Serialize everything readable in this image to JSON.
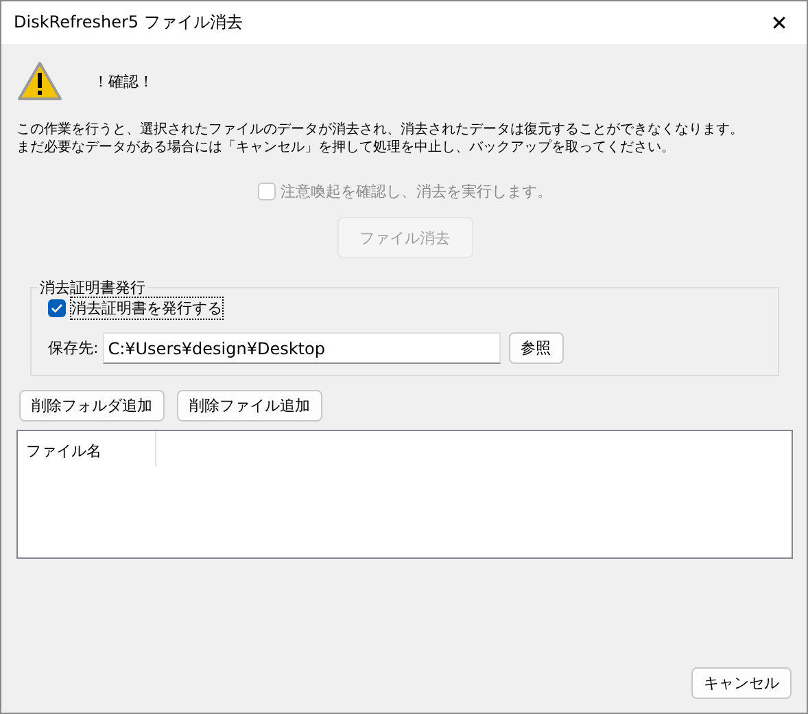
{
  "window": {
    "title": "DiskRefresher5 ファイル消去",
    "close": "✕"
  },
  "warning": {
    "heading": "！確認！",
    "lines": [
      "この作業を行うと、選択されたファイルのデータが消去され、消去されたデータは復元することができなくなります。",
      "まだ必要なデータがある場合には「キャンセル」を押して処理を中止し、バックアップを取ってください。"
    ]
  },
  "confirm_checkbox": {
    "label": "注意喚起を確認し、消去を実行します。",
    "checked": false,
    "disabled": true
  },
  "erase_button": {
    "label": "ファイル消去",
    "disabled": true
  },
  "certificate": {
    "legend": "消去証明書発行",
    "checkbox": {
      "label": "消去証明書を発行する",
      "checked": true
    },
    "save_to": {
      "label": "保存先:",
      "value": "C:¥Users¥design¥Desktop"
    },
    "browse_button": "参照"
  },
  "add_buttons": [
    "削除フォルダ追加",
    "削除ファイル追加"
  ],
  "file_list": {
    "columns": [
      "ファイル名"
    ]
  },
  "cancel_button": "キャンセル"
}
